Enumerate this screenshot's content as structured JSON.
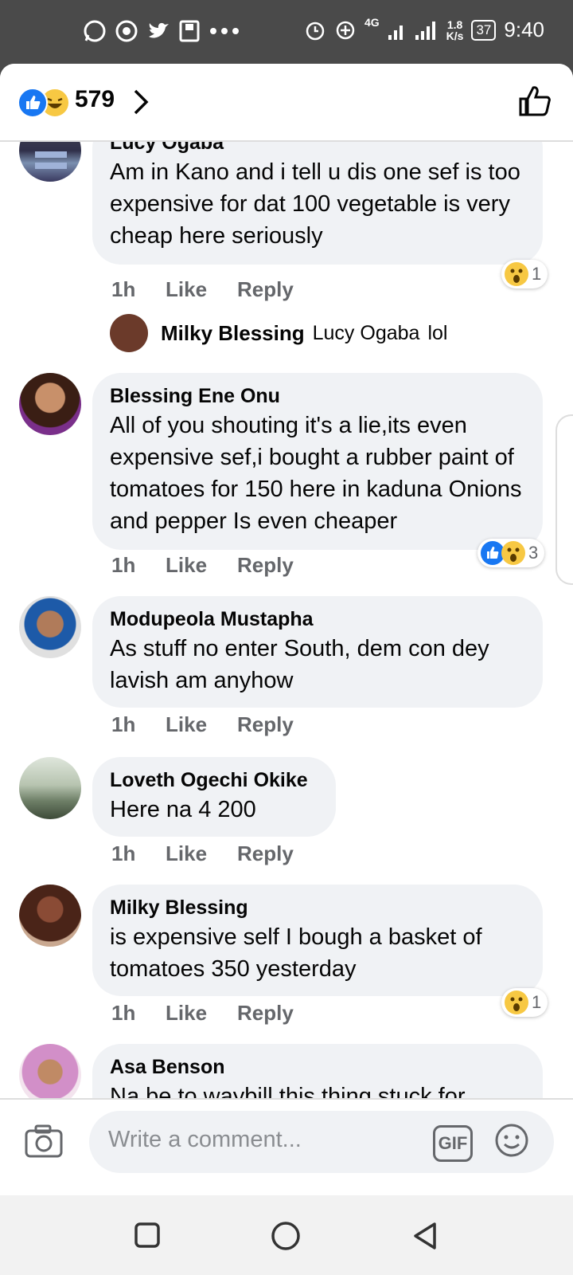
{
  "status_bar": {
    "left_icons": [
      "whatsapp-icon",
      "chrome-icon",
      "twitter-icon",
      "save-icon",
      "more-dots-icon"
    ],
    "network": "4G",
    "speed_value": "1.8",
    "speed_unit": "K/s",
    "battery": "37",
    "time": "9:40"
  },
  "header": {
    "reaction_count": "579"
  },
  "comments": [
    {
      "name": "Lucy Ogaba",
      "text": "Am in Kano and i tell u dis one sef is too expensive for dat 100 vegetable is very cheap here seriously",
      "time": "1h",
      "like": "Like",
      "reply": "Reply",
      "reactions_count": "1"
    },
    {
      "name": "Blessing Ene Onu",
      "text": "All of you shouting it's a lie,its even expensive sef,i bought a rubber paint of tomatoes for 150 here in kaduna Onions and pepper Is even cheaper",
      "time": "1h",
      "like": "Like",
      "reply": "Reply",
      "reactions_count": "3"
    },
    {
      "name": "Modupeola Mustapha",
      "text": "As stuff no enter South, dem con dey lavish am anyhow",
      "time": "1h",
      "like": "Like",
      "reply": "Reply"
    },
    {
      "name": "Loveth Ogechi Okike",
      "text": "Here na 4 200",
      "time": "1h",
      "like": "Like",
      "reply": "Reply"
    },
    {
      "name": "Milky Blessing",
      "text": "is expensive self I bough a basket of tomatoes 350 yesterday",
      "time": "1h",
      "like": "Like",
      "reply": "Reply",
      "reactions_count": "1"
    },
    {
      "name": "Asa Benson",
      "text": "Na be to waybill this thing stuck for"
    }
  ],
  "reply_preview": {
    "name": "Milky Blessing",
    "mention": "Lucy Ogaba",
    "text": "lol"
  },
  "composer": {
    "placeholder": "Write a comment...",
    "gif_label": "GIF"
  }
}
